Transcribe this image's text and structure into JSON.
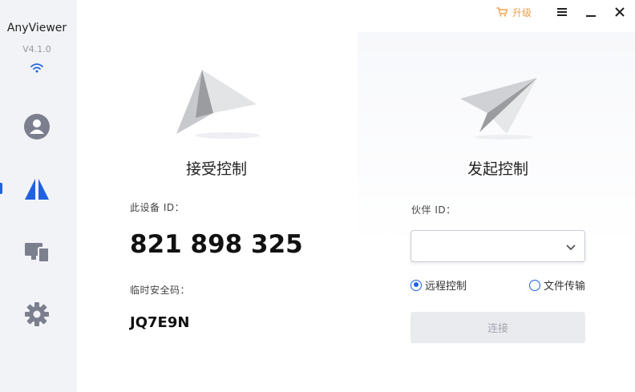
{
  "app": {
    "name": "AnyViewer",
    "version": "V4.1.0"
  },
  "sidebar": {
    "items": [
      {
        "name": "account",
        "icon": "user-icon"
      },
      {
        "name": "remote-control",
        "icon": "anyviewer-logo-icon",
        "active": true
      },
      {
        "name": "devices",
        "icon": "devices-icon"
      },
      {
        "name": "settings",
        "icon": "gear-icon"
      }
    ]
  },
  "titlebar": {
    "upgrade_label": "升级"
  },
  "receive": {
    "heading": "接受控制",
    "device_id_label": "此设备 ID：",
    "device_id": "821 898 325",
    "temp_code_label": "临时安全码：",
    "temp_code": "JQ7E9N"
  },
  "initiate": {
    "heading": "发起控制",
    "partner_id_label": "伙伴 ID：",
    "partner_id_value": "",
    "options": [
      {
        "label": "远程控制",
        "checked": true
      },
      {
        "label": "文件传输",
        "checked": false
      }
    ],
    "connect_label": "连接"
  },
  "colors": {
    "accent": "#1e62e0",
    "upgrade": "#f0a04b",
    "sidebar_bg": "#f2f3f6",
    "icon_gray": "#7b7f8e"
  }
}
